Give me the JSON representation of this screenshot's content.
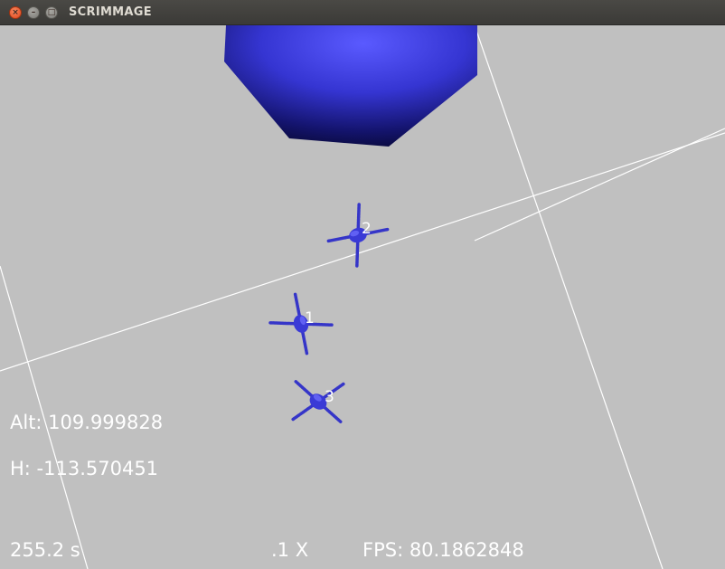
{
  "window": {
    "title": "SCRIMMAGE",
    "buttons": {
      "close": "×",
      "minimize": "–",
      "maximize": "□"
    }
  },
  "hud": {
    "altitude": "Alt: 109.999828",
    "heading": "H: -113.570451",
    "sim_time": "255.2 s",
    "time_warp": ".1 X",
    "fps": "FPS: 80.1862848"
  },
  "agents": [
    {
      "id": "1"
    },
    {
      "id": "2"
    },
    {
      "id": "3"
    }
  ],
  "colors": {
    "ground": "#c0c0c0",
    "grid_line": "#ffffff",
    "entity": "#3a3ad6",
    "sphere": "#3b3bdc",
    "title_bar": "#3c3b37"
  }
}
